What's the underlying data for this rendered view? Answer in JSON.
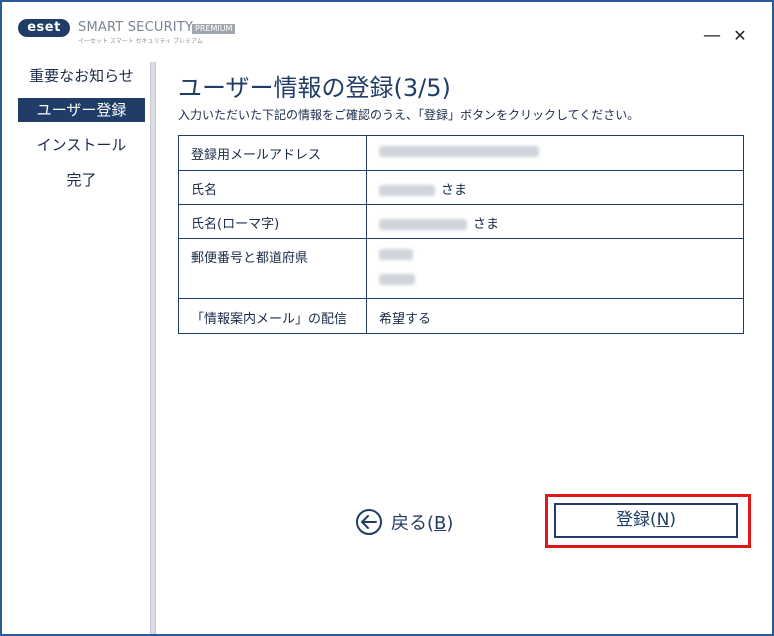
{
  "app": {
    "logo_text": "eset",
    "product_name": "SMART SECURITY",
    "product_badge": "PREMIUM",
    "product_sub": "イーセット スマート セキュリティ プレミアム"
  },
  "window_controls": {
    "minimize": "—",
    "close": "✕"
  },
  "sidebar": {
    "items": [
      {
        "label": "重要なお知らせ",
        "active": false
      },
      {
        "label": "ユーザー登録",
        "active": true
      },
      {
        "label": "インストール",
        "active": false
      },
      {
        "label": "完了",
        "active": false
      }
    ]
  },
  "main": {
    "title": "ユーザー情報の登録(3/5)",
    "description": "入力いただいた下記の情報をご確認のうえ、「登録」ボタンをクリックしてください。",
    "rows": [
      {
        "label": "登録用メールアドレス",
        "suffix": ""
      },
      {
        "label": "氏名",
        "suffix": "さま"
      },
      {
        "label": "氏名(ローマ字)",
        "suffix": "さま"
      },
      {
        "label": "郵便番号と都道府県",
        "suffix": ""
      },
      {
        "label": "「情報案内メール」の配信",
        "value": "希望する"
      }
    ]
  },
  "actions": {
    "back_label": "戻る(",
    "back_key": "B",
    "back_close": ")",
    "register_label": "登録(",
    "register_key": "N",
    "register_close": ")",
    "highlight_color": "#e01818"
  }
}
